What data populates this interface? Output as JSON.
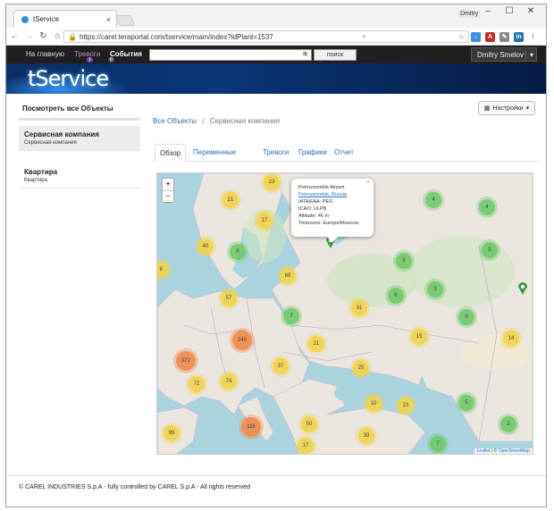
{
  "browser": {
    "tab_title": "tService",
    "user_badge": "Dmitry",
    "url": "https://carel.teraportal.com/tservice/main/index?idPlant=1537"
  },
  "topnav": {
    "home": "На главную",
    "alarms": "Тревоги",
    "alarms_count": "1",
    "events": "События",
    "events_count": "0",
    "search_button": "поиск",
    "user": "Dmitry Smelov"
  },
  "banner": {
    "logo": "tService"
  },
  "sidebar": {
    "title": "Посмотреть все Объекты",
    "items": [
      {
        "title": "Сервисная компания",
        "subtitle": "Сервисная компания"
      },
      {
        "title": "Квартира",
        "subtitle": "Квартира"
      }
    ]
  },
  "main": {
    "breadcrumb_root": "Все Объекты",
    "breadcrumb_sep": "/",
    "breadcrumb_current": "Сервисная компания",
    "settings_button": "Настройки",
    "tabs": [
      "Обзор",
      "Переменные",
      "Тревоги",
      "Графики",
      "Отчет"
    ]
  },
  "map": {
    "zoom_in": "+",
    "zoom_out": "−",
    "popup": {
      "name": "Petrozavodsk Airport",
      "city": "Petrozavodsk, Russia",
      "iata": "IATA/FAA: PES",
      "icao": "ICAO: ULPB",
      "altitude": "Altitude: 46 m",
      "timezone": "Timezone: Europe/Moscow"
    },
    "attribution_leaflet": "Leaflet",
    "attribution_sep": " | © ",
    "attribution_osm": "OpenStreetMap",
    "clusters": [
      {
        "label": "23",
        "color": "#f1d349"
      },
      {
        "label": "21",
        "color": "#f1d349"
      },
      {
        "label": "17",
        "color": "#f1d349"
      },
      {
        "label": "40",
        "color": "#f1d349"
      },
      {
        "label": "8",
        "color": "#6fc86a"
      },
      {
        "label": "9",
        "color": "#f1d349"
      },
      {
        "label": "69",
        "color": "#f1d349"
      },
      {
        "label": "57",
        "color": "#f1d349"
      },
      {
        "label": "7",
        "color": "#6fc86a"
      },
      {
        "label": "31",
        "color": "#f1d349"
      },
      {
        "label": "249",
        "color": "#ef8a4a"
      },
      {
        "label": "21",
        "color": "#f1d349"
      },
      {
        "label": "372",
        "color": "#ef8a4a"
      },
      {
        "label": "37",
        "color": "#f1d349"
      },
      {
        "label": "25",
        "color": "#f1d349"
      },
      {
        "label": "72",
        "color": "#f1d349"
      },
      {
        "label": "74",
        "color": "#f1d349"
      },
      {
        "label": "10",
        "color": "#f1d349"
      },
      {
        "label": "23",
        "color": "#f1d349"
      },
      {
        "label": "118",
        "color": "#ef8a4a"
      },
      {
        "label": "50",
        "color": "#f1d349"
      },
      {
        "label": "39",
        "color": "#f1d349"
      },
      {
        "label": "99",
        "color": "#f1d349"
      },
      {
        "label": "17",
        "color": "#f1d349"
      },
      {
        "label": "4",
        "color": "#6fc86a"
      },
      {
        "label": "4",
        "color": "#6fc86a"
      },
      {
        "label": "5",
        "color": "#6fc86a"
      },
      {
        "label": "5",
        "color": "#6fc86a"
      },
      {
        "label": "6",
        "color": "#6fc86a"
      },
      {
        "label": "3",
        "color": "#6fc86a"
      },
      {
        "label": "9",
        "color": "#6fc86a"
      },
      {
        "label": "15",
        "color": "#f1d349"
      },
      {
        "label": "14",
        "color": "#f1d349"
      },
      {
        "label": "5",
        "color": "#6fc86a"
      },
      {
        "label": "2",
        "color": "#6fc86a"
      },
      {
        "label": "7",
        "color": "#6fc86a"
      }
    ]
  },
  "footer": {
    "text": "© CAREL INDUSTRIES S.p.A - fully controlled by CAREL S.p.A - All rights reserved"
  }
}
